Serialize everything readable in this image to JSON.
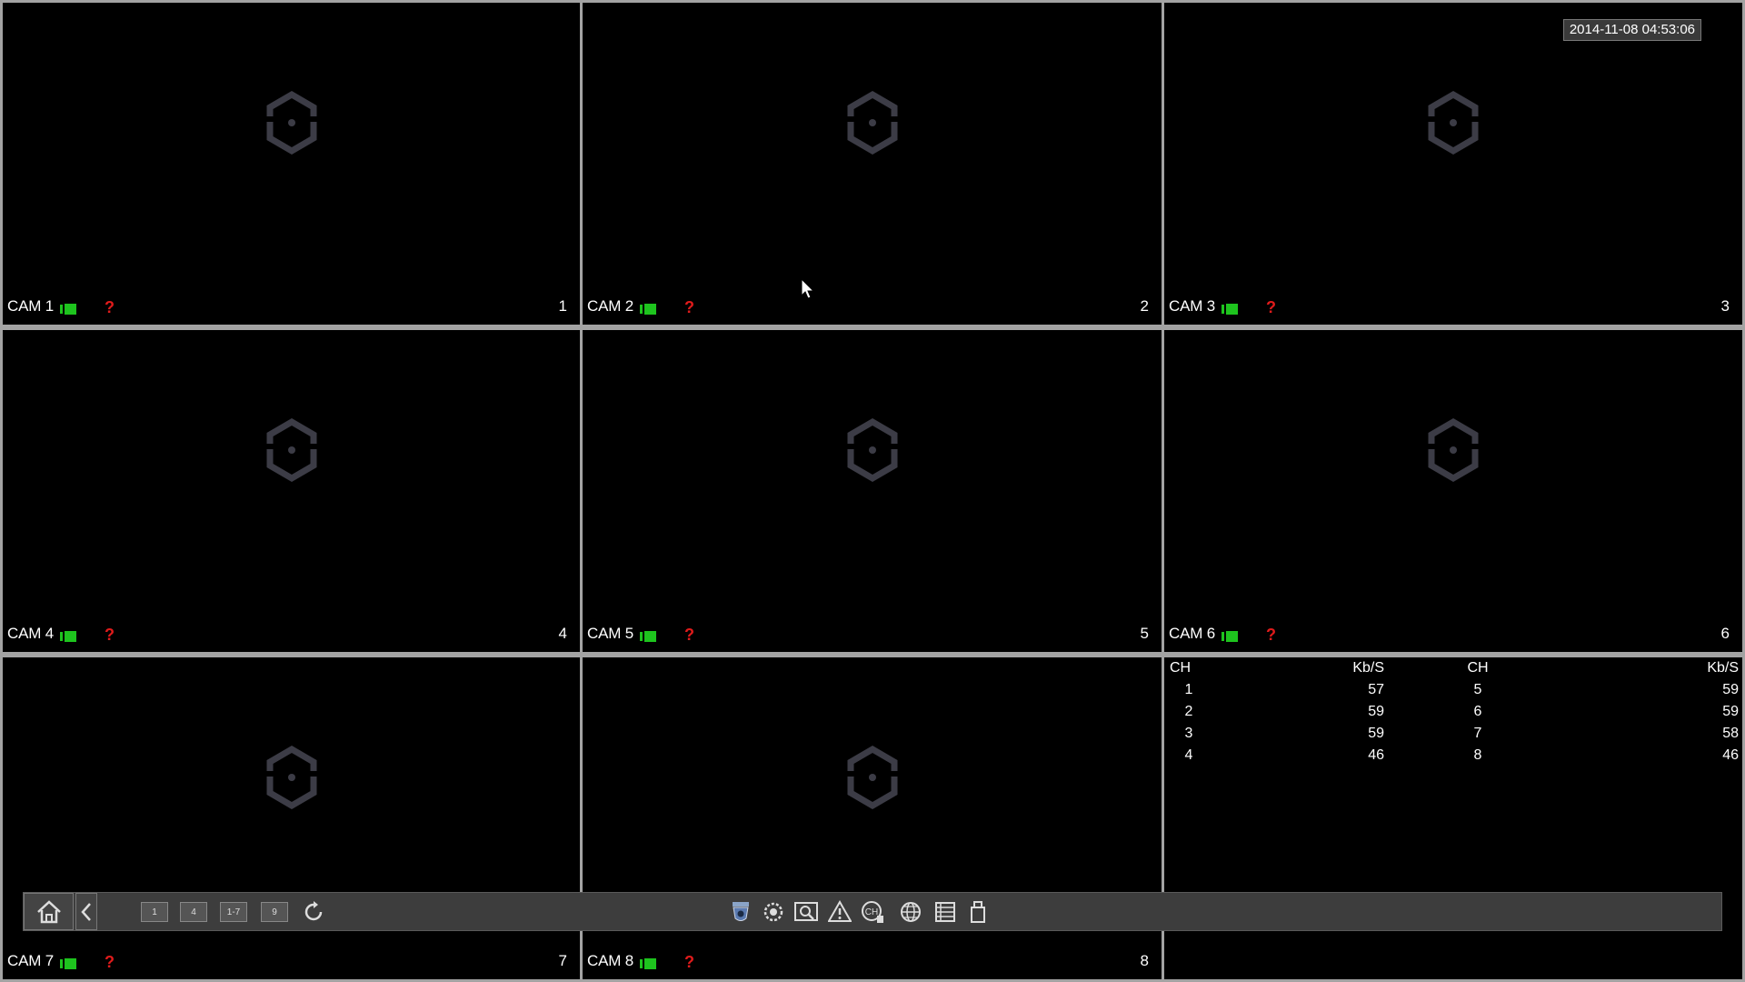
{
  "timestamp": "2014-11-08 04:53:06",
  "cameras": [
    {
      "label": "CAM 1",
      "number": "1"
    },
    {
      "label": "CAM 2",
      "number": "2"
    },
    {
      "label": "CAM 3",
      "number": "3"
    },
    {
      "label": "CAM 4",
      "number": "4"
    },
    {
      "label": "CAM 5",
      "number": "5"
    },
    {
      "label": "CAM 6",
      "number": "6"
    },
    {
      "label": "CAM 7",
      "number": "7"
    },
    {
      "label": "CAM 8",
      "number": "8"
    }
  ],
  "status_icons": {
    "recording": "recording-icon",
    "no_signal": "?",
    "no_signal_color": "#e01b1b",
    "recording_color": "#1ec41e"
  },
  "bitrate_table": {
    "headers": [
      "CH",
      "Kb/S",
      "CH",
      "Kb/S"
    ],
    "rows": [
      [
        "1",
        "57",
        "5",
        "59"
      ],
      [
        "2",
        "59",
        "6",
        "59"
      ],
      [
        "3",
        "59",
        "7",
        "58"
      ],
      [
        "4",
        "46",
        "8",
        "46"
      ]
    ]
  },
  "taskbar": {
    "split_buttons": [
      "1",
      "4",
      "1-7",
      "9"
    ],
    "tools": [
      "ptz-icon",
      "color-icon",
      "search-icon",
      "alarm-icon",
      "channel-info-icon",
      "network-icon",
      "log-icon",
      "usb-icon"
    ]
  }
}
